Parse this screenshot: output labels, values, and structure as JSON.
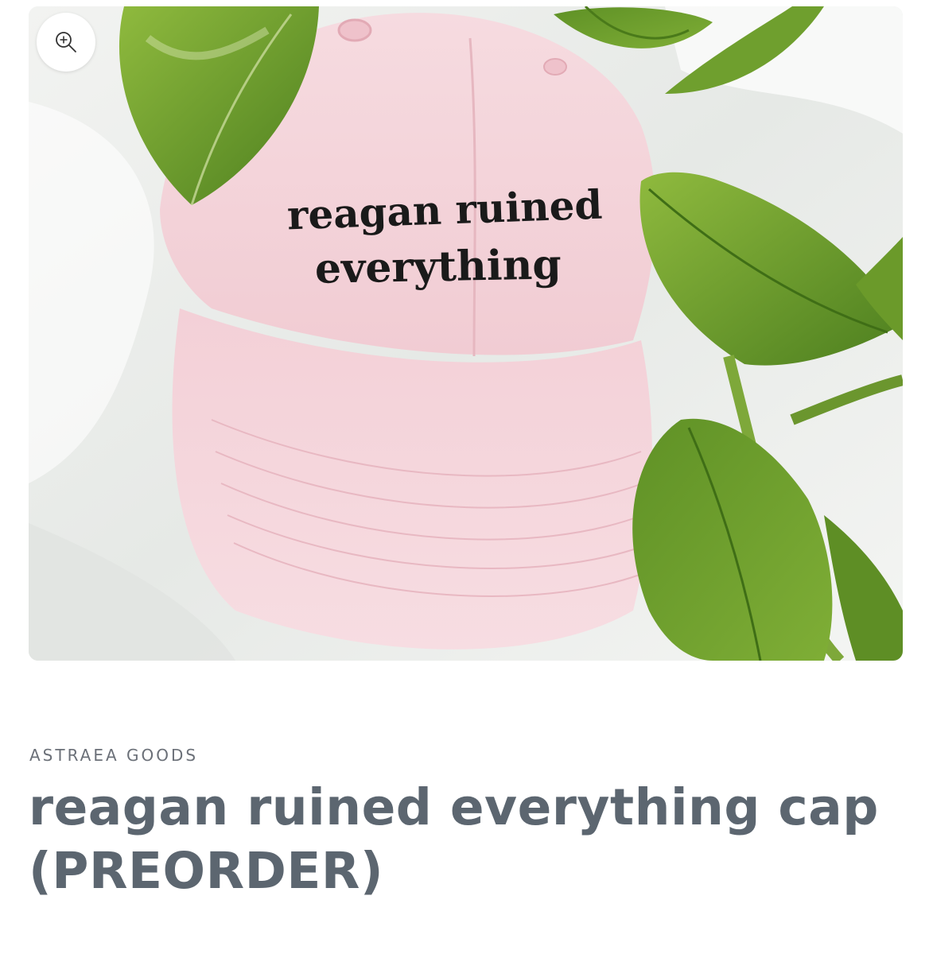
{
  "media": {
    "hat_text_line1": "reagan ruined",
    "hat_text_line2": "everything",
    "zoom_icon": "zoom-in-icon"
  },
  "product": {
    "vendor": "ASTRAEA GOODS",
    "title": "reagan ruined everything cap (PREORDER)"
  },
  "colors": {
    "title": "#5c6670",
    "vendor": "#6b7078",
    "hat": "#f5d6dc",
    "leaf": "#6a9a2c"
  }
}
